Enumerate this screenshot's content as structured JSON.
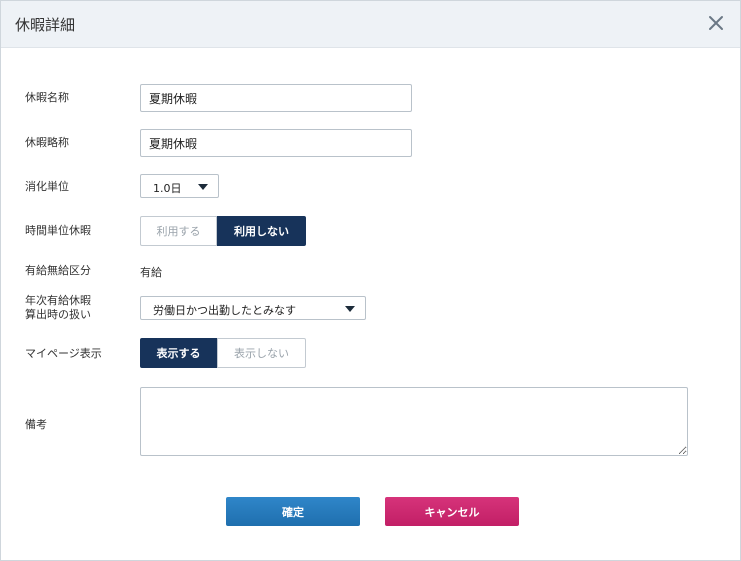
{
  "dialog": {
    "title": "休暇詳細"
  },
  "form": {
    "vacation_name": {
      "label": "休暇名称",
      "value": "夏期休暇"
    },
    "vacation_short_name": {
      "label": "休暇略称",
      "value": "夏期休暇"
    },
    "consumption_unit": {
      "label": "消化単位",
      "selected": "1.0日"
    },
    "hourly_vacation": {
      "label": "時間単位休暇",
      "options": [
        "利用する",
        "利用しない"
      ],
      "selected": "利用しない"
    },
    "paid_type": {
      "label": "有給無給区分",
      "value": "有給"
    },
    "annual_leave_calc": {
      "label_line1": "年次有給休暇",
      "label_line2": "算出時の扱い",
      "selected": "労働日かつ出勤したとみなす"
    },
    "mypage_display": {
      "label": "マイページ表示",
      "options": [
        "表示する",
        "表示しない"
      ],
      "selected": "表示する"
    },
    "remarks": {
      "label": "備考",
      "value": ""
    }
  },
  "buttons": {
    "confirm": "確定",
    "cancel": "キャンセル"
  },
  "colors": {
    "header_bg": "#eef2f6",
    "toggle_active": "#17335a",
    "confirm": "#2679bd",
    "cancel": "#cc2a70"
  }
}
